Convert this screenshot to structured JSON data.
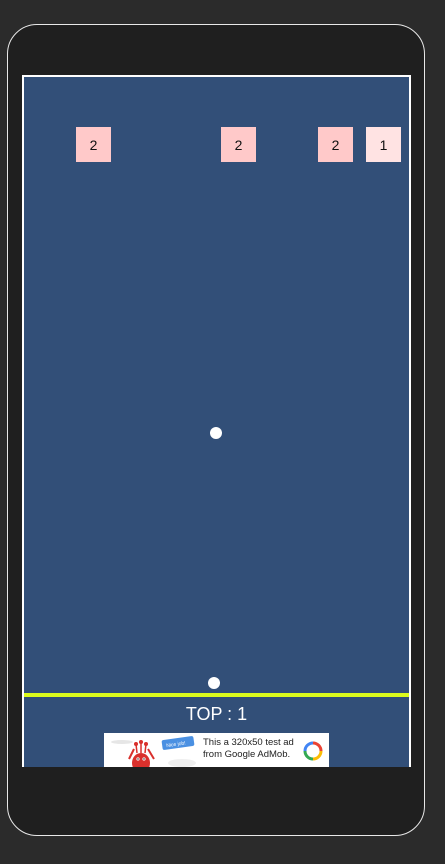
{
  "game": {
    "bricks": [
      {
        "value": "2",
        "color": "#ffc9c9"
      },
      {
        "value": "2",
        "color": "#ffc9c9"
      },
      {
        "value": "2",
        "color": "#ffc9c9"
      },
      {
        "value": "1",
        "color": "#ffe3e3"
      }
    ],
    "colors": {
      "background": "#324f78",
      "floor_line": "#dcfc1c",
      "ball": "#ffffff"
    },
    "top_score": "TOP : 1"
  },
  "ad": {
    "text": "This a 320x50 test ad from Google AdMob.",
    "badge": "Nice job!",
    "art_icon": "alien-mascot-icon",
    "logo_icon": "admob-logo-icon"
  }
}
